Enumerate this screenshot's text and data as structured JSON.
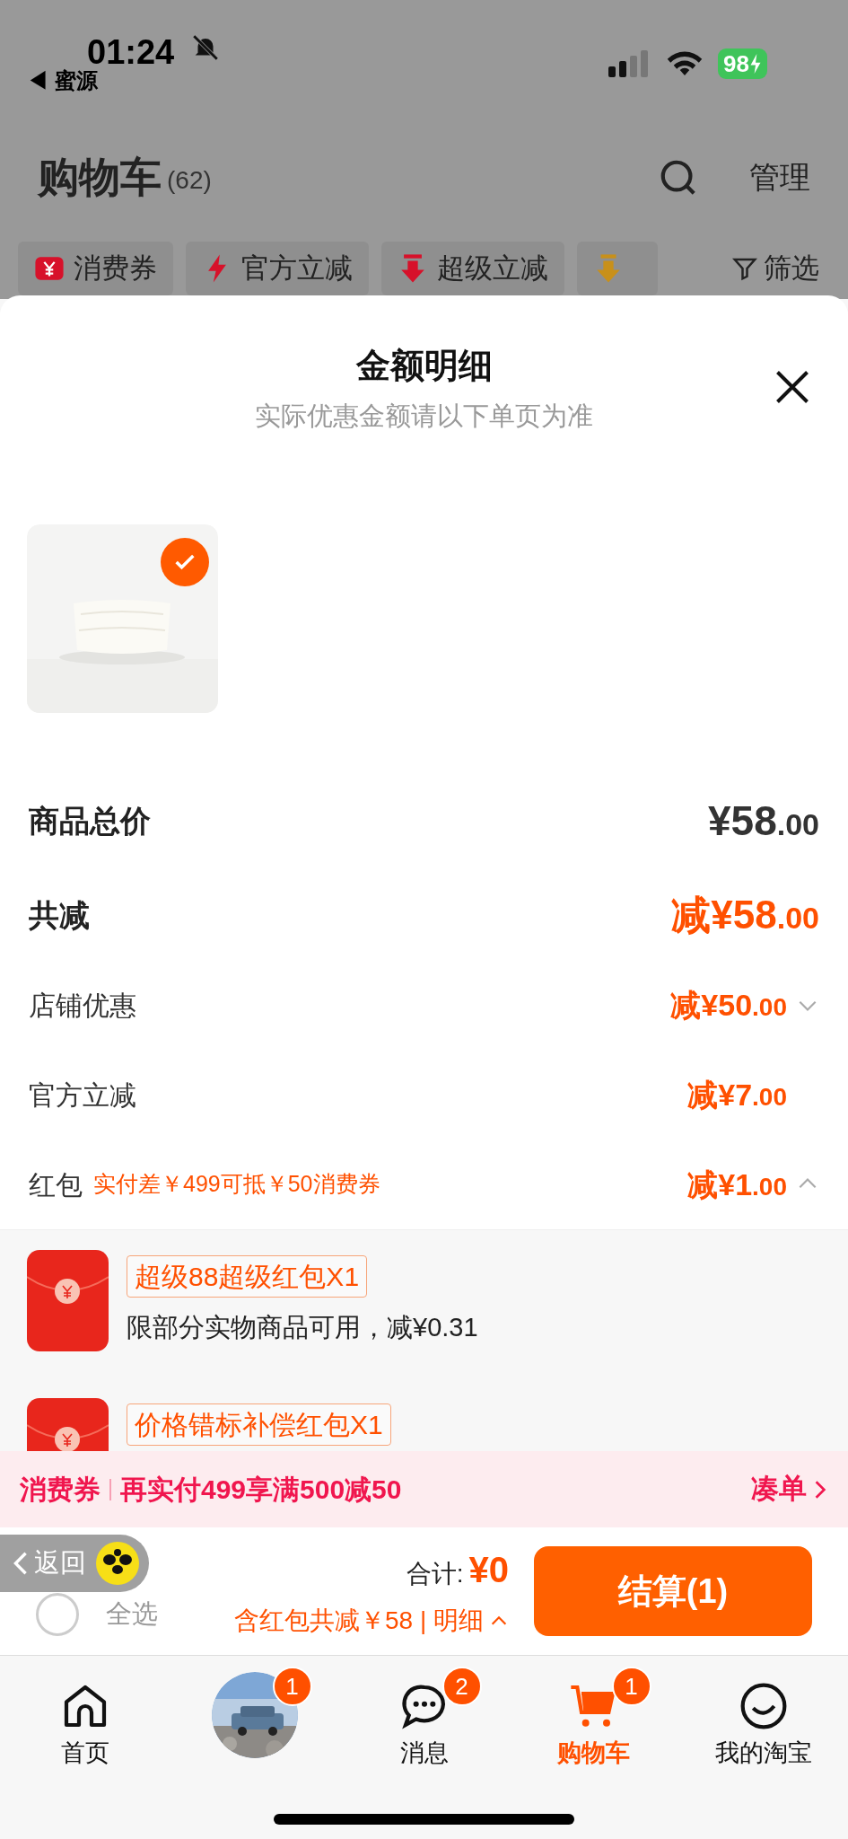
{
  "status_bar": {
    "time": "01:24",
    "back_app": "◀ 蜜源",
    "battery": "98"
  },
  "header": {
    "title": "购物车",
    "count": "(62)",
    "manage": "管理"
  },
  "filter_chips": [
    {
      "kind": "coupon",
      "label": "消费券"
    },
    {
      "kind": "bolt",
      "label": "官方立减"
    },
    {
      "kind": "down",
      "label": "超级立减"
    },
    {
      "kind": "coin"
    }
  ],
  "filter": "筛选",
  "sheet": {
    "title": "金额明细",
    "subtitle": "实际优惠金额请以下单页为准",
    "product": {
      "checked": true
    },
    "rows": [
      {
        "kind": "total",
        "label": "商品总价",
        "amount": "¥58.00"
      },
      {
        "kind": "discount",
        "label": "共减",
        "amount": "减¥58.00"
      },
      {
        "kind": "sub",
        "label": "店铺优惠",
        "amount": "减¥50.00",
        "expanded": false
      },
      {
        "kind": "sub",
        "label": "官方立减",
        "amount": "减¥7.00"
      },
      {
        "kind": "sub",
        "label": "红包",
        "note": "实付差￥499可抵￥50消费券",
        "amount": "减¥1.00",
        "expanded": true
      }
    ],
    "red_packets": [
      {
        "tag": "超级88超级红包X1",
        "description": "限部分实物商品可用，减¥0.31"
      },
      {
        "tag": "价格错标补偿红包X1"
      }
    ]
  },
  "promo_bar": {
    "label": "消费券",
    "text": "再实付499享满500减50",
    "action": "凑单"
  },
  "back_overlay": "返回",
  "checkout": {
    "select_all": {
      "label": "全选",
      "checked": false
    },
    "total_label": "合计:",
    "total": "¥0",
    "savings": "含红包共减￥58 | 明细",
    "button": "结算(1)"
  },
  "tabs": [
    {
      "kind": "home",
      "label": "首页",
      "selected": false
    },
    {
      "kind": "avatar",
      "badge": "1",
      "selected": false
    },
    {
      "kind": "chat",
      "label": "消息",
      "badge": "2",
      "selected": false
    },
    {
      "kind": "cart",
      "label": "购物车",
      "badge": "1",
      "selected": true
    },
    {
      "kind": "face",
      "label": "我的淘宝",
      "selected": false
    }
  ]
}
